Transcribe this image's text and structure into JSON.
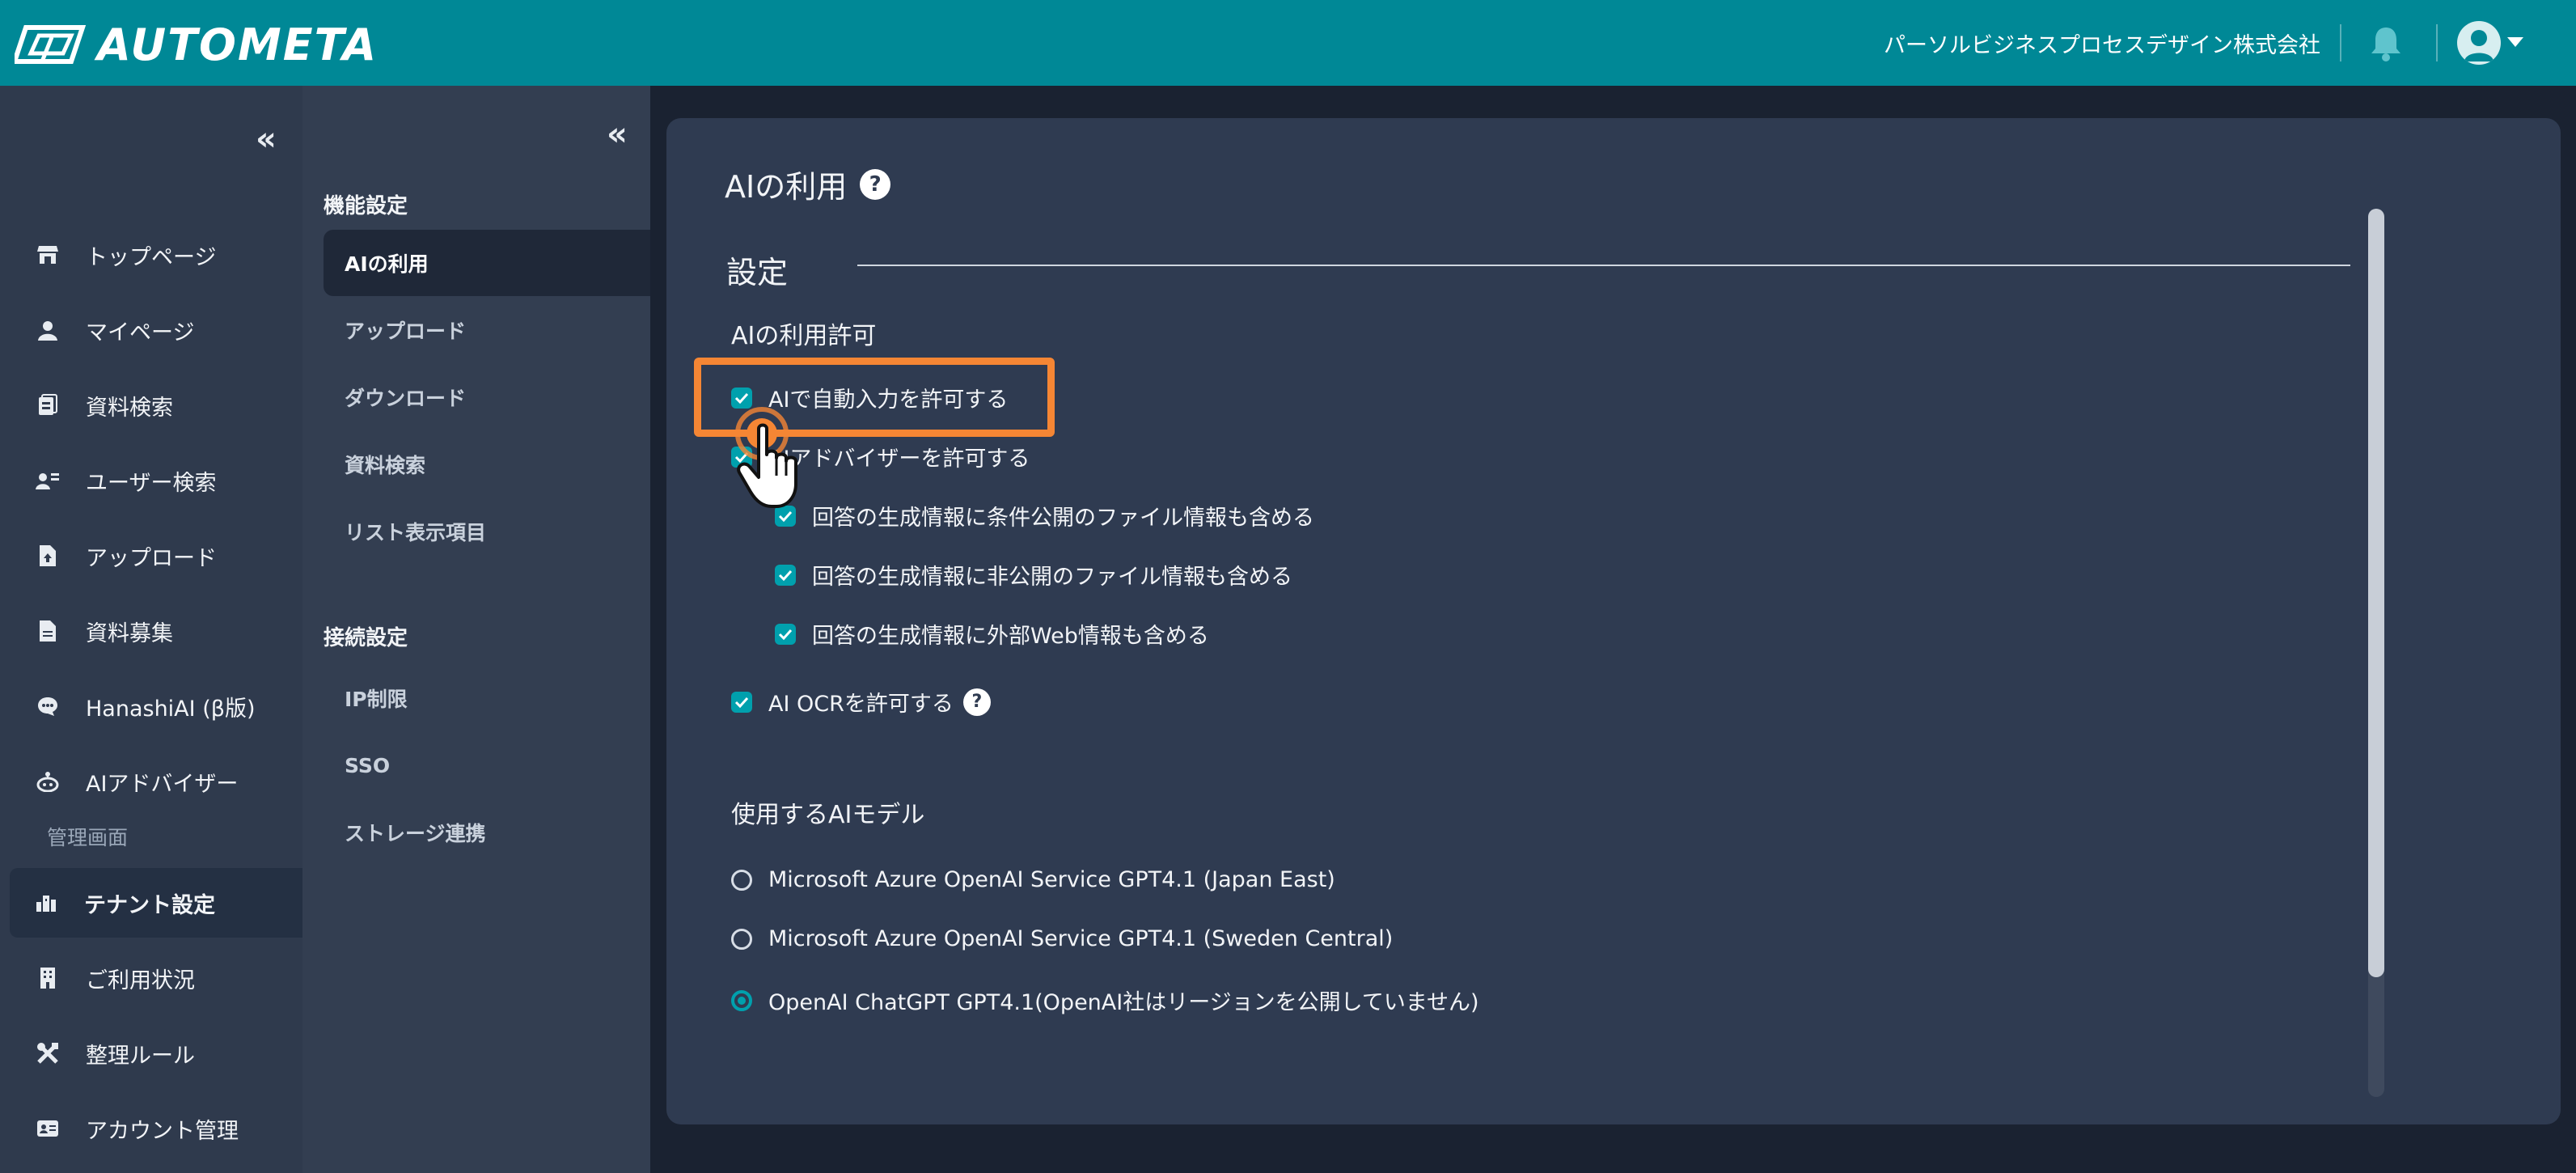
{
  "header": {
    "logo_text": "AUTOMETA",
    "company": "パーソルビジネスプロセスデザイン株式会社"
  },
  "sidebar": {
    "items": [
      {
        "label": "トップページ",
        "icon": "store-icon"
      },
      {
        "label": "マイページ",
        "icon": "person-icon"
      },
      {
        "label": "資料検索",
        "icon": "document-search-icon"
      },
      {
        "label": "ユーザー検索",
        "icon": "user-search-icon"
      },
      {
        "label": "アップロード",
        "icon": "upload-file-icon"
      },
      {
        "label": "資料募集",
        "icon": "file-icon"
      },
      {
        "label": "HanashiAI (β版)",
        "icon": "chat-icon"
      },
      {
        "label": "AIアドバイザー",
        "icon": "robot-icon"
      }
    ],
    "admin_section": "管理画面",
    "admin_items": [
      {
        "label": "テナント設定",
        "icon": "tenant-icon",
        "active": true
      },
      {
        "label": "ご利用状況",
        "icon": "building-icon"
      },
      {
        "label": "整理ルール",
        "icon": "tools-icon"
      },
      {
        "label": "アカウント管理",
        "icon": "id-card-icon"
      }
    ]
  },
  "subnav": {
    "group1": "機能設定",
    "group1_items": [
      "AIの利用",
      "アップロード",
      "ダウンロード",
      "資料検索",
      "リスト表示項目"
    ],
    "group2": "接続設定",
    "group2_items": [
      "IP制限",
      "SSO",
      "ストレージ連携"
    ]
  },
  "main": {
    "title": "AIの利用",
    "help": "?",
    "section": "設定",
    "permission_label": "AIの利用許可",
    "permissions": [
      {
        "label": "AIで自動入力を許可する",
        "checked": true
      },
      {
        "label": "AIアドバイザーを許可する",
        "checked": true
      }
    ],
    "sub_permissions": [
      {
        "label": "回答の生成情報に条件公開のファイル情報も含める",
        "checked": true
      },
      {
        "label": "回答の生成情報に非公開のファイル情報も含める",
        "checked": true
      },
      {
        "label": "回答の生成情報に外部Web情報も含める",
        "checked": true
      }
    ],
    "ocr": {
      "label": "AI OCRを許可する",
      "checked": true,
      "help": "?"
    },
    "model_label": "使用するAIモデル",
    "models": [
      {
        "label": "Microsoft Azure OpenAI Service GPT4.1 (Japan East)",
        "selected": false
      },
      {
        "label": "Microsoft Azure OpenAI Service GPT4.1 (Sweden Central)",
        "selected": false
      },
      {
        "label": "OpenAI ChatGPT GPT4.1(OpenAI社はリージョンを公開していません)",
        "selected": true
      }
    ]
  },
  "colors": {
    "header": "#008896",
    "accent": "#00a0ad",
    "highlight": "#f58634"
  }
}
